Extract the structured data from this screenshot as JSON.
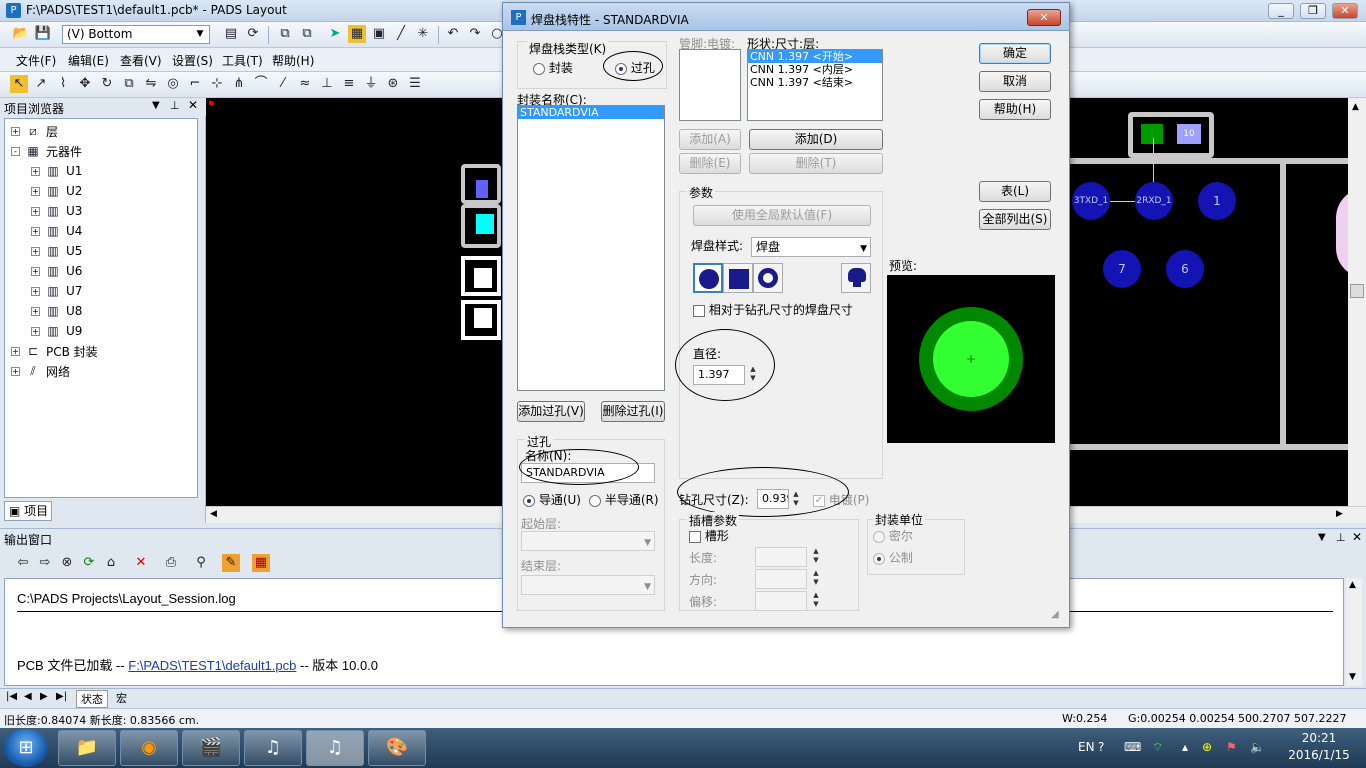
{
  "app": {
    "title": "F:\\PADS\\TEST1\\default1.pcb* - PADS Layout",
    "layer_select": "(V) Bottom"
  },
  "menu": [
    "文件(F)",
    "编辑(E)",
    "查看(V)",
    "设置(S)",
    "工具(T)",
    "帮助(H)"
  ],
  "browser": {
    "title": "项目浏览器",
    "tab": "项目",
    "tree": [
      {
        "label": "层",
        "icon": "layers-icon",
        "exp": "+"
      },
      {
        "label": "元器件",
        "icon": "component-icon",
        "exp": "-"
      },
      {
        "label": "U1",
        "icon": "chip-icon",
        "exp": "+"
      },
      {
        "label": "U2",
        "icon": "chip-icon",
        "exp": "+"
      },
      {
        "label": "U3",
        "icon": "chip-icon",
        "exp": "+"
      },
      {
        "label": "U4",
        "icon": "chip-icon",
        "exp": "+"
      },
      {
        "label": "U5",
        "icon": "chip-icon",
        "exp": "+"
      },
      {
        "label": "U6",
        "icon": "chip-icon",
        "exp": "+"
      },
      {
        "label": "U7",
        "icon": "chip-icon",
        "exp": "+"
      },
      {
        "label": "U8",
        "icon": "chip-icon",
        "exp": "+"
      },
      {
        "label": "U9",
        "icon": "chip-icon",
        "exp": "+"
      },
      {
        "label": "PCB 封装",
        "icon": "footprint-icon",
        "exp": "+"
      },
      {
        "label": "网络",
        "icon": "net-icon",
        "exp": "+"
      }
    ]
  },
  "canvas": {
    "labels": {
      "pad_a": "3TXD_1",
      "pad_b": "2RXD_1",
      "pad_c": "1",
      "pad_d": "7",
      "pad_e": "6",
      "pad_f": "10"
    },
    "colors": {
      "background": "#000000",
      "board_outline": "#c8c8c8",
      "pad_blue": "#1414b4",
      "pad_green": "#009900",
      "pad_cyan": "#00ffff"
    }
  },
  "output": {
    "title": "输出窗口",
    "log_file": "C:\\PADS Projects\\Layout_Session.log",
    "msg_prefix": "PCB 文件已加载  --",
    "msg_link": "F:\\PADS\\TEST1\\default1.pcb",
    "msg_suffix": "--  版本  10.0.0",
    "tabs": [
      "状态",
      "宏"
    ]
  },
  "status": {
    "left": "旧长度:0.84074 新长度: 0.83566 cm.",
    "w": "W:0.254",
    "g": "G:0.00254 0.00254",
    "xy": "500.2707  507.2227"
  },
  "taskbar": {
    "time": "20:21",
    "date": "2016/1/15",
    "lang": "EN"
  },
  "dialog": {
    "title": "焊盘栈特性 - STANDARDVIA",
    "padstack_type_label": "焊盘栈类型(K)",
    "type_options": [
      "封装",
      "过孔"
    ],
    "type_selected": "过孔",
    "name_label": "封装名称(C):",
    "name_items": [
      "STANDARDVIA"
    ],
    "add_via": "添加过孔(V)",
    "del_via": "删除过孔(I)",
    "via_group": "过孔",
    "via_name_label": "名称(N):",
    "via_name_value": "STANDARDVIA",
    "via_through": "导通(U)",
    "via_partial": "半导通(R)",
    "start_layer": "起始层:",
    "end_layer": "结束层:",
    "pin_label": "管脚:电镀:",
    "shape_label": "形状:尺寸:层:",
    "shape_items": [
      "CNN 1.397 <开始>",
      "CNN 1.397 <内层>",
      "CNN 1.397 <结束>"
    ],
    "add_a": "添加(A)",
    "del_e": "删除(E)",
    "add_d": "添加(D)",
    "del_t": "删除(T)",
    "param_group": "参数",
    "use_global": "使用全局默认值(F)",
    "pad_style_label": "焊盘样式:",
    "pad_style_value": "焊盘",
    "relative_check": "相对于钻孔尺寸的焊盘尺寸",
    "diameter_label": "直径:",
    "diameter_value": "1.397",
    "drill_label": "钻孔尺寸(Z):",
    "drill_value": "0.939",
    "plated_label": "电镀(P)",
    "slot_group": "插槽参数",
    "slot_check": "槽形",
    "length_label": "长度:",
    "direction_label": "方向:",
    "offset_label": "偏移:",
    "units_group": "封装单位",
    "unit_mil": "密尔",
    "unit_metric": "公制",
    "preview_label": "预览:",
    "ok": "确定",
    "cancel": "取消",
    "help": "帮助(H)",
    "table": "表(L)",
    "list_all": "全部列出(S)",
    "preview_colors": {
      "outer": "#008800",
      "inner": "#33ff33",
      "bg": "#000000"
    }
  }
}
